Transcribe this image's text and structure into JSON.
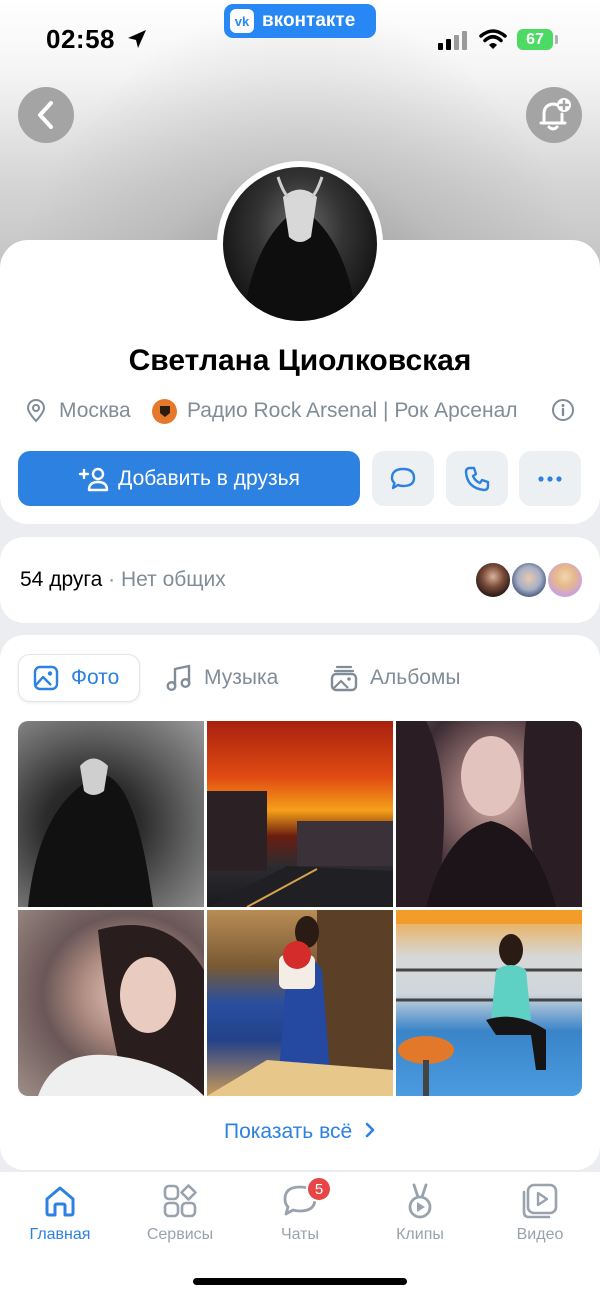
{
  "status_bar": {
    "time": "02:58",
    "app_pill": "вконтакте",
    "app_pill_logo": "vk",
    "battery": "67"
  },
  "header": {
    "back_icon": "chevron-left-icon",
    "notify_icon": "bell-plus-icon"
  },
  "profile": {
    "name": "Светлана Циолковская",
    "city": "Москва",
    "job": "Радио Rock Arsenal | Рок Арсенал",
    "add_friend_label": "Добавить в друзья"
  },
  "friends": {
    "count_label": "54 друга",
    "separator": "·",
    "mutual_label": "Нет общих"
  },
  "media": {
    "tabs": [
      {
        "label": "Фото",
        "icon": "image-icon",
        "active": true
      },
      {
        "label": "Музыка",
        "icon": "music-icon",
        "active": false
      },
      {
        "label": "Альбомы",
        "icon": "albums-icon",
        "active": false
      }
    ],
    "show_all_label": "Показать всё"
  },
  "nav": {
    "items": [
      {
        "label": "Главная",
        "icon": "home-icon",
        "active": true
      },
      {
        "label": "Сервисы",
        "icon": "services-icon",
        "active": false
      },
      {
        "label": "Чаты",
        "icon": "chat-icon",
        "active": false,
        "badge": "5"
      },
      {
        "label": "Клипы",
        "icon": "clips-icon",
        "active": false
      },
      {
        "label": "Видео",
        "icon": "video-icon",
        "active": false
      }
    ]
  },
  "colors": {
    "accent": "#2d81e0",
    "vk_blue": "#2787f5",
    "secondary_text": "#818c99",
    "badge_red": "#e64646",
    "battery_green": "#4cd964"
  }
}
